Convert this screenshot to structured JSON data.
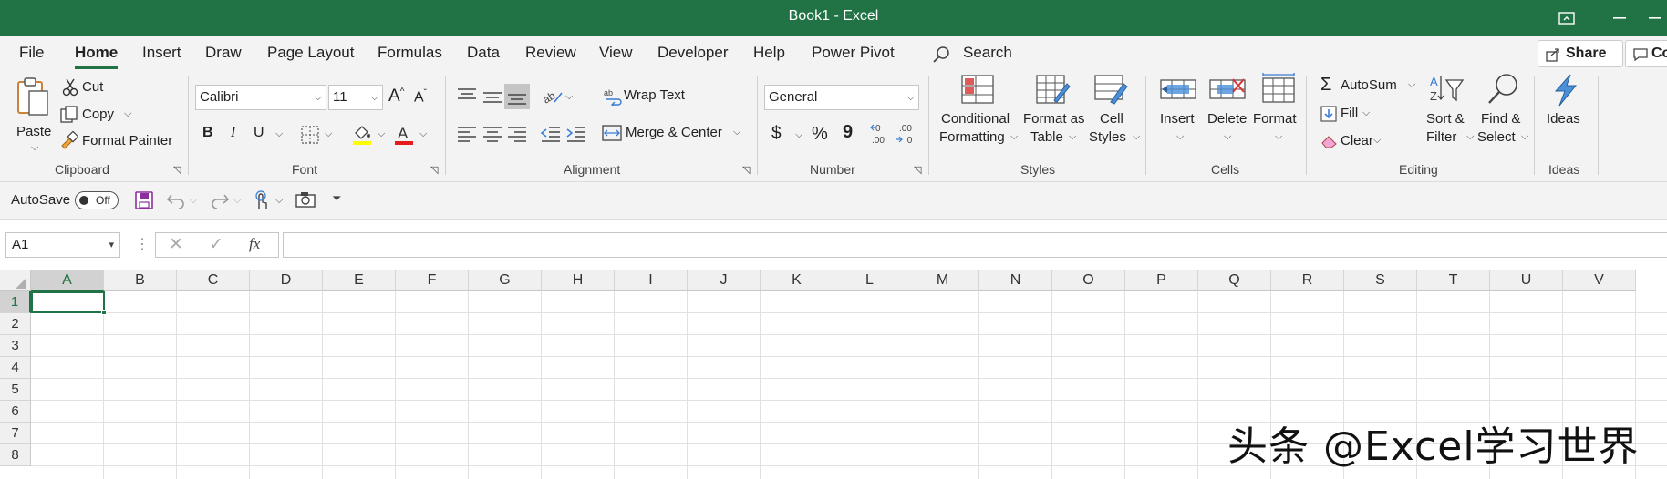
{
  "window": {
    "title": "Book1  -  Excel"
  },
  "tabs": [
    "File",
    "Home",
    "Insert",
    "Draw",
    "Page Layout",
    "Formulas",
    "Data",
    "Review",
    "View",
    "Developer",
    "Help",
    "Power Pivot"
  ],
  "search": {
    "label": "Search"
  },
  "share": {
    "label": "Share",
    "comments_label": "Co"
  },
  "clipboard": {
    "paste": "Paste",
    "cut": "Cut",
    "copy": "Copy",
    "format_painter": "Format Painter",
    "group": "Clipboard"
  },
  "font": {
    "name": "Calibri",
    "size": "11",
    "bold": "B",
    "italic": "I",
    "underline": "U",
    "group": "Font"
  },
  "alignment": {
    "wrap_text": "Wrap Text",
    "merge_center": "Merge & Center",
    "group": "Alignment"
  },
  "number": {
    "format": "General",
    "currency": "$",
    "percent": "%",
    "comma": "9",
    "group": "Number"
  },
  "styles": {
    "conditional_1": "Conditional",
    "conditional_2": "Formatting",
    "format_table_1": "Format as",
    "format_table_2": "Table",
    "cell_styles_1": "Cell",
    "cell_styles_2": "Styles",
    "group": "Styles"
  },
  "cells": {
    "insert": "Insert",
    "delete": "Delete",
    "format": "Format",
    "group": "Cells"
  },
  "editing": {
    "autosum": "AutoSum",
    "fill": "Fill",
    "clear": "Clear",
    "sort_1": "Sort &",
    "sort_2": "Filter",
    "find_1": "Find &",
    "find_2": "Select",
    "group": "Editing"
  },
  "ideas": {
    "label": "Ideas",
    "group": "Ideas"
  },
  "qat": {
    "autosave": "AutoSave",
    "toggle": "Off"
  },
  "formula_bar": {
    "name_box": "A1",
    "fx": "fx",
    "value": ""
  },
  "columns": [
    "A",
    "B",
    "C",
    "D",
    "E",
    "F",
    "G",
    "H",
    "I",
    "J",
    "K",
    "L",
    "M",
    "N",
    "O",
    "P",
    "Q",
    "R",
    "S",
    "T",
    "U",
    "V"
  ],
  "rows": [
    "1",
    "2",
    "3",
    "4",
    "5",
    "6",
    "7",
    "8"
  ],
  "watermark": "头条 @Excel学习世界",
  "colors": {
    "accent": "#217346",
    "font_color": "#e51c1c",
    "highlight": "#ffff00"
  }
}
